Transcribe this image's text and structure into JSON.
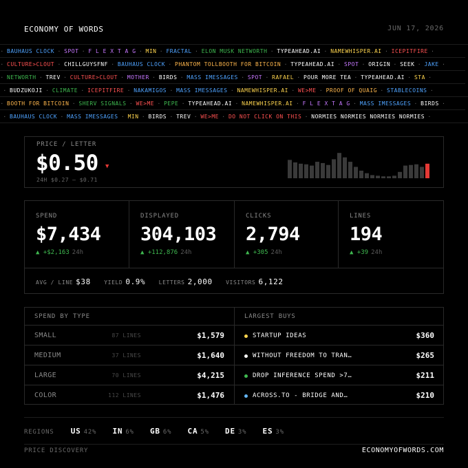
{
  "header": {
    "title": "ECONOMY OF WORDS",
    "date": "JUN 17, 2026"
  },
  "ticker": [
    [
      "BAUHAUS CLOCK|#4fa3ff",
      "SPOT|#c678ff",
      "F L E X T A G|#c678ff",
      "MIN|#ffd54f",
      "FRACTAL|#4fa3ff",
      "ELON MUSK NETWORTH|#3fb950",
      "TYPEAHEAD.AI|#ffffff",
      "NAMEWHISPER.AI|#ffd54f",
      "ICEPITFIRE|#ff5252"
    ],
    [
      "CULTURE>CLOUT|#ff5252",
      "CHILLGUYSFNF|#ffffff",
      "BAUHAUS CLOCK|#4fa3ff",
      "PHANTOM TOLLBOOTH FOR BITCOIN|#ffb74d",
      "TYPEAHEAD.AI|#ffffff",
      "SPOT|#c678ff",
      "ORIGIN|#ffffff",
      "SEEK|#ffffff",
      "JAKE|#4fa3ff"
    ],
    [
      "NETWORTH|#3fb950",
      "TREV|#ffffff",
      "CULTURE>CLOUT|#ff5252",
      "MOTHER|#c678ff",
      "BIRDS|#ffffff",
      "MASS IMESSAGES|#4fa3ff",
      "SPOT|#c678ff",
      "RAFAEL|#ffd54f",
      "POUR MORE TEA|#ffffff",
      "TYPEAHEAD.AI|#ffffff",
      "STA|#ffd54f"
    ],
    [
      "BUDZUKOJI|#ffffff",
      "CLIMATE|#3fb950",
      "ICEPITFIRE|#ff5252",
      "NAKAMIGOS|#4fa3ff",
      "MASS IMESSAGES|#4fa3ff",
      "NAMEWHISPER.AI|#ffd54f",
      "WE>ME|#ff5252",
      "PROOF OF QUAIG|#ffb74d",
      "STABLECOINS|#4fa3ff"
    ],
    [
      "BOOTH FOR BITCOIN|#ffb74d",
      "SHERV SIGNALS|#3fb950",
      "WE>ME|#ff5252",
      "PEPE|#3fb950",
      "TYPEAHEAD.AI|#ffffff",
      "NAMEWHISPER.AI|#ffd54f",
      "F L E X T A G|#c678ff",
      "MASS IMESSAGES|#4fa3ff",
      "BIRDS|#ffffff"
    ],
    [
      "BAUHAUS CLOCK|#4fa3ff",
      "MASS IMESSAGES|#4fa3ff",
      "MIN|#ffd54f",
      "BIRDS|#ffffff",
      "TREV|#ffffff",
      "WE>ME|#ff5252",
      "DO NOT CLICK ON THIS|#ff5252",
      "NORMIES NORMIES NORMIES NORMIES|#ffffff"
    ]
  ],
  "price": {
    "label": "PRICE / LETTER",
    "value": "$0.50",
    "direction_icon": "triangle-down-icon",
    "range": "24H $0.27 – $0.71",
    "sparkline": [
      0.58,
      0.5,
      0.46,
      0.44,
      0.4,
      0.52,
      0.48,
      0.42,
      0.6,
      0.8,
      0.66,
      0.52,
      0.36,
      0.24,
      0.16,
      0.1,
      0.08,
      0.06,
      0.06,
      0.08,
      0.2,
      0.4,
      0.42,
      0.44,
      0.36,
      0.46
    ],
    "bar_color": "#3a3a3a",
    "last_bar_color": "#e53935"
  },
  "stats": [
    {
      "label": "SPEND",
      "value": "$7,434",
      "change": "+$2,163",
      "period": "24h"
    },
    {
      "label": "DISPLAYED",
      "value": "304,103",
      "change": "+112,876",
      "period": "24h"
    },
    {
      "label": "CLICKS",
      "value": "2,794",
      "change": "+305",
      "period": "24h"
    },
    {
      "label": "LINES",
      "value": "194",
      "change": "+39",
      "period": "24h"
    }
  ],
  "substats": [
    {
      "label": "AVG / LINE",
      "value": "$38"
    },
    {
      "label": "YIELD",
      "value": "0.9%"
    },
    {
      "label": "LETTERS",
      "value": "2,000"
    },
    {
      "label": "VISITORS",
      "value": "6,122"
    }
  ],
  "spend_by_type": {
    "title": "SPEND BY TYPE",
    "rows": [
      {
        "name": "SMALL",
        "lines": "87 LINES",
        "amount": "$1,579"
      },
      {
        "name": "MEDIUM",
        "lines": "37 LINES",
        "amount": "$1,640"
      },
      {
        "name": "LARGE",
        "lines": "70 LINES",
        "amount": "$4,215"
      },
      {
        "name": "COLOR",
        "lines": "112 LINES",
        "amount": "$1,476"
      }
    ]
  },
  "largest_buys": {
    "title": "LARGEST BUYS",
    "rows": [
      {
        "name": "STARTUP IDEAS",
        "amount": "$360",
        "color": "#ffd54f"
      },
      {
        "name": "WITHOUT FREEDOM TO TRAN…",
        "amount": "$265",
        "color": "#ffffff"
      },
      {
        "name": "DROP INFERENCE SPEND >7…",
        "amount": "$211",
        "color": "#3fb950"
      },
      {
        "name": "ACROSS.TO - BRIDGE AND…",
        "amount": "$210",
        "color": "#64b5f6"
      }
    ]
  },
  "regions": {
    "label": "REGIONS",
    "items": [
      {
        "code": "US",
        "pct": "42%"
      },
      {
        "code": "IN",
        "pct": "6%"
      },
      {
        "code": "GB",
        "pct": "6%"
      },
      {
        "code": "CA",
        "pct": "5%"
      },
      {
        "code": "DE",
        "pct": "3%"
      },
      {
        "code": "ES",
        "pct": "3%"
      }
    ]
  },
  "footer": {
    "left": "PRICE DISCOVERY",
    "right": "ECONOMYOFWORDS.COM"
  },
  "colors": {
    "up": "#3fb950",
    "down": "#e53935",
    "border": "#2a2a2a"
  }
}
